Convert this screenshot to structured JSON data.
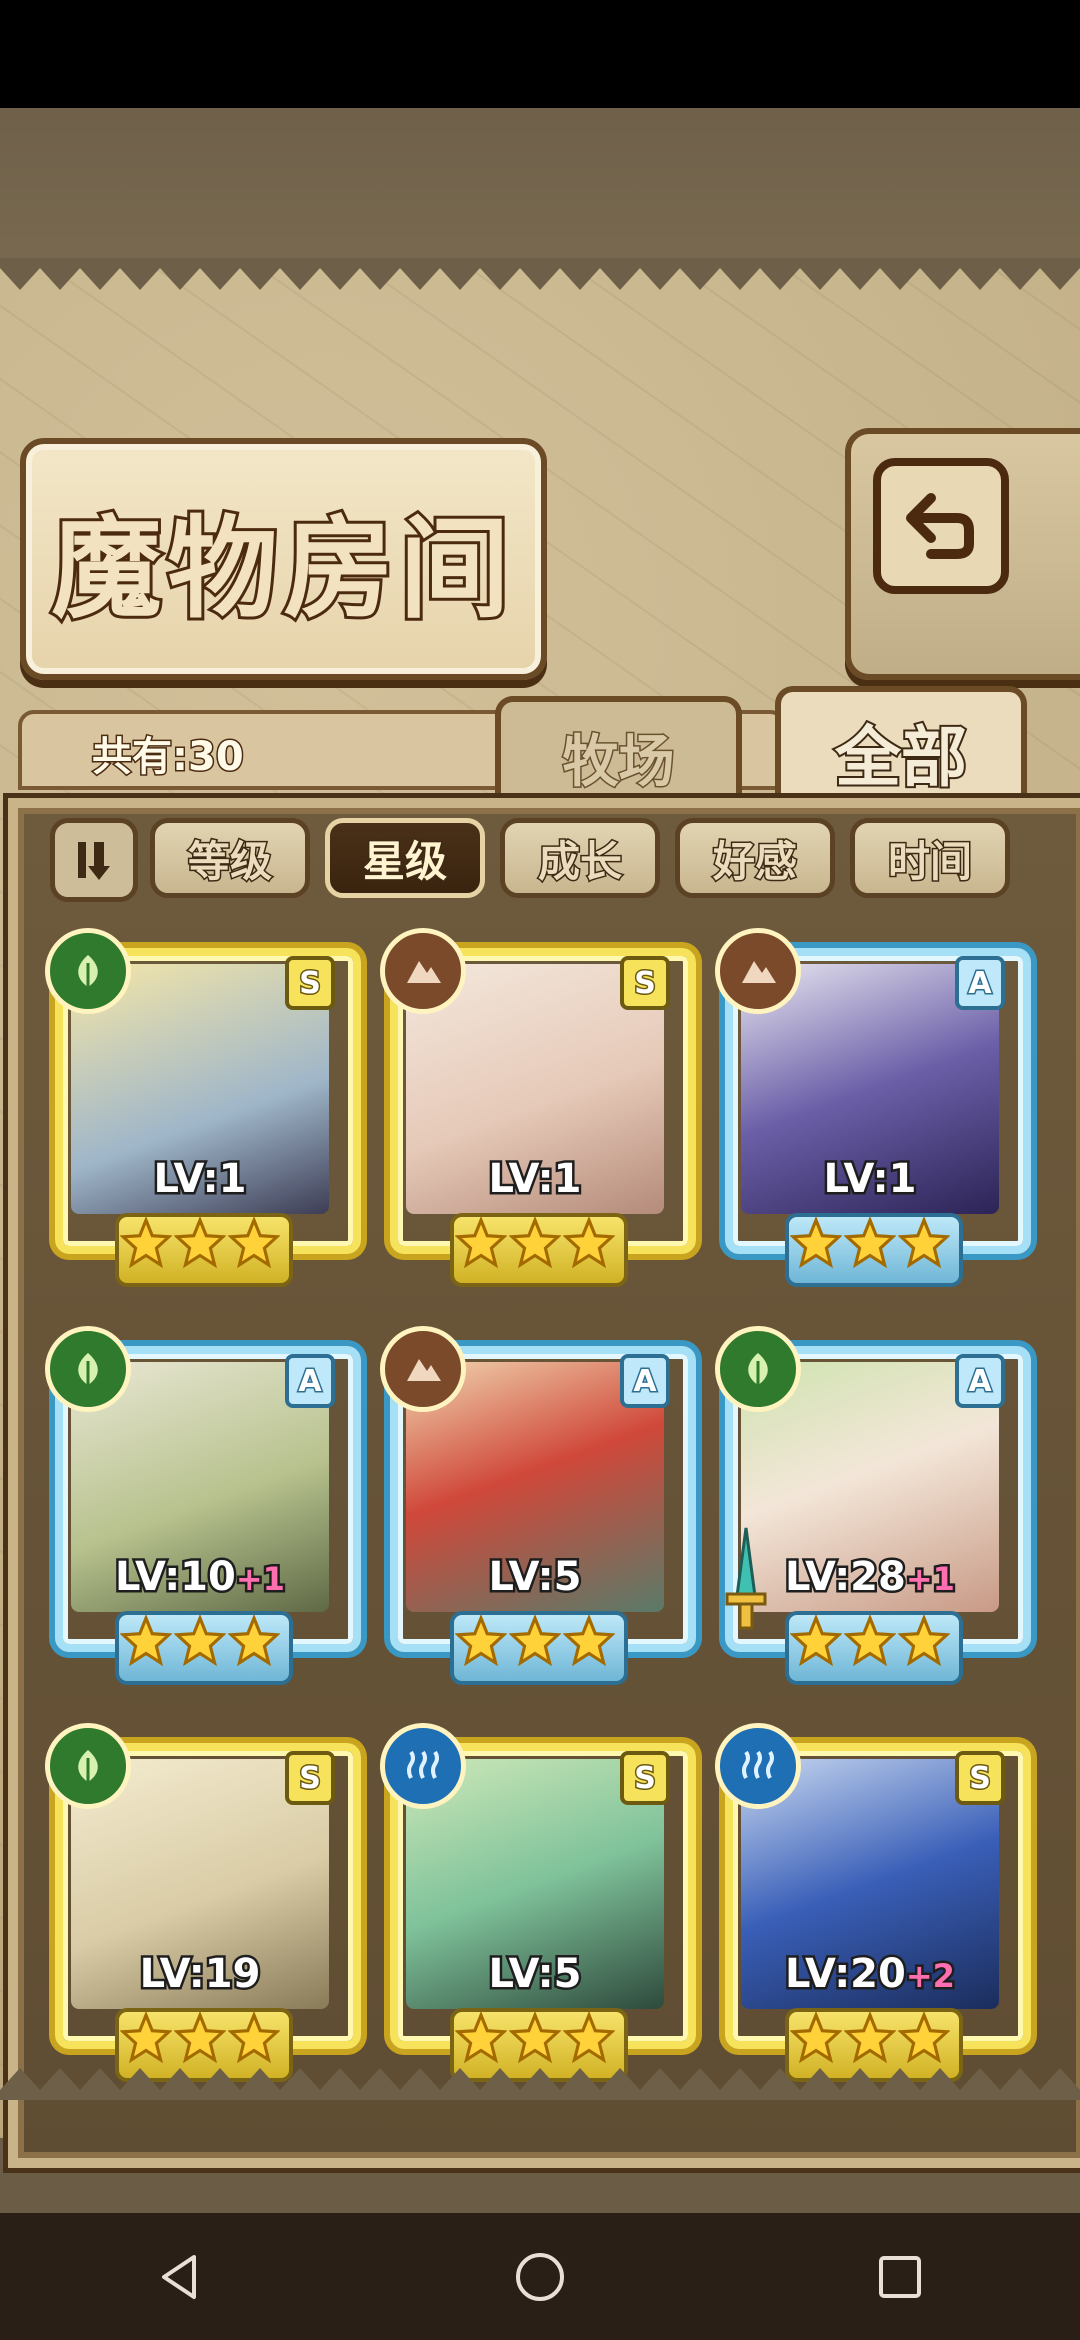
{
  "header": {
    "title": "魔物房间"
  },
  "count": {
    "label": "共有:30"
  },
  "tabs": [
    {
      "label": "牧场",
      "active": false
    },
    {
      "label": "全部",
      "active": true
    }
  ],
  "sort": {
    "toggle_icon": "sort-order-icon",
    "buttons": [
      {
        "label": "等级",
        "active": false
      },
      {
        "label": "星级",
        "active": true
      },
      {
        "label": "成长",
        "active": false
      },
      {
        "label": "好感",
        "active": false
      },
      {
        "label": "时间",
        "active": false
      }
    ]
  },
  "cards": [
    {
      "rank": "S",
      "element": "leaf",
      "level": "LV:1",
      "bonus": "",
      "stars": 3
    },
    {
      "rank": "S",
      "element": "mountain",
      "level": "LV:1",
      "bonus": "",
      "stars": 3
    },
    {
      "rank": "A",
      "element": "mountain",
      "level": "LV:1",
      "bonus": "",
      "stars": 3
    },
    {
      "rank": "A",
      "element": "leaf",
      "level": "LV:10",
      "bonus": "+1",
      "stars": 3
    },
    {
      "rank": "A",
      "element": "mountain",
      "level": "LV:5",
      "bonus": "",
      "stars": 3
    },
    {
      "rank": "A",
      "element": "leaf",
      "level": "LV:28",
      "bonus": "+1",
      "stars": 3
    },
    {
      "rank": "S",
      "element": "leaf",
      "level": "LV:19",
      "bonus": "",
      "stars": 3
    },
    {
      "rank": "S",
      "element": "water",
      "level": "LV:5",
      "bonus": "",
      "stars": 3
    },
    {
      "rank": "S",
      "element": "water",
      "level": "LV:20",
      "bonus": "+2",
      "stars": 3
    }
  ],
  "colors": {
    "leaf": "#2f7a2c",
    "mountain": "#7a4a2a",
    "water": "#1f6fb5"
  },
  "nav": [
    {
      "icon": "back-triangle-icon"
    },
    {
      "icon": "home-circle-icon"
    },
    {
      "icon": "recents-square-icon"
    }
  ]
}
